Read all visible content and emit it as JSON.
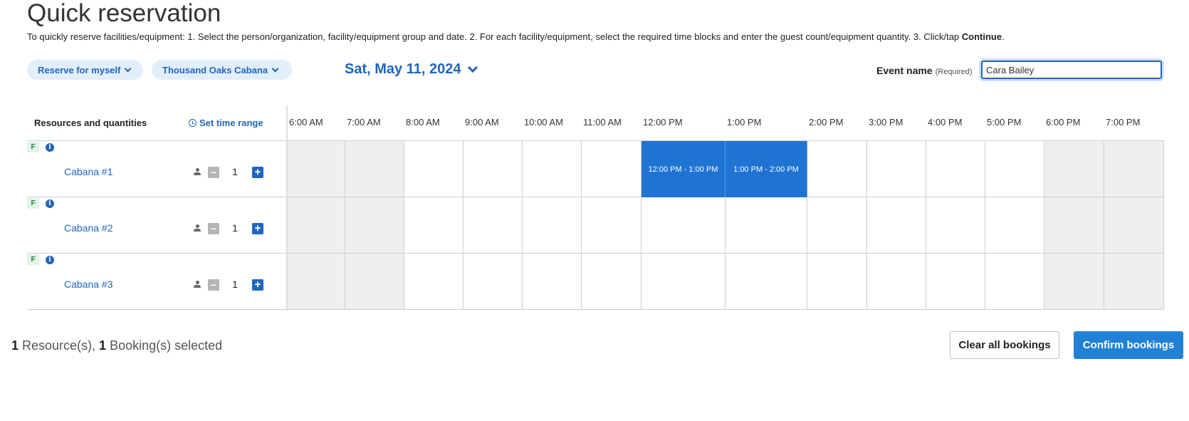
{
  "header": {
    "title": "Quick reservation",
    "instructions_prefix": "To quickly reserve facilities/equipment: 1. Select the person/organization, facility/equipment group and date. 2. For each facility/equipment, select the required time blocks and enter the guest count/equipment quantity. 3. Click/tap ",
    "instructions_bold": "Continue",
    "instructions_suffix": "."
  },
  "filters": {
    "reserve_for": "Reserve for myself",
    "facility_group": "Thousand Oaks Cabana",
    "date": "Sat, May 11, 2024"
  },
  "event": {
    "label": "Event name",
    "required": "(Required)",
    "value": "Cara Bailey"
  },
  "grid": {
    "resources_heading": "Resources and quantities",
    "set_time_range": "Set time range",
    "time_labels": [
      "6:00 AM",
      "7:00 AM",
      "8:00 AM",
      "9:00 AM",
      "10:00 AM",
      "11:00 AM",
      "12:00 PM",
      "1:00 PM",
      "2:00 PM",
      "3:00 PM",
      "4:00 PM",
      "5:00 PM",
      "6:00 PM",
      "7:00 PM"
    ],
    "unavailable_columns": [
      0,
      1,
      12,
      13
    ],
    "resources": [
      {
        "type_badge": "F",
        "name": "Cabana #1",
        "quantity": "1",
        "bookings": [
          {
            "label": "12:00 PM  -  1:00 PM"
          },
          {
            "label": "1:00 PM  -  2:00 PM"
          }
        ]
      },
      {
        "type_badge": "F",
        "name": "Cabana #2",
        "quantity": "1",
        "bookings": []
      },
      {
        "type_badge": "F",
        "name": "Cabana #3",
        "quantity": "1",
        "bookings": []
      }
    ]
  },
  "summary": {
    "resource_count": "1",
    "resource_text": " Resource(s), ",
    "booking_count": "1",
    "booking_text": " Booking(s) selected"
  },
  "actions": {
    "clear_label": "Clear all bookings",
    "confirm_label": "Confirm bookings"
  },
  "colors": {
    "accent": "#1f66bd",
    "booking_fill": "#1f74d3",
    "unavailable": "#efefef"
  }
}
